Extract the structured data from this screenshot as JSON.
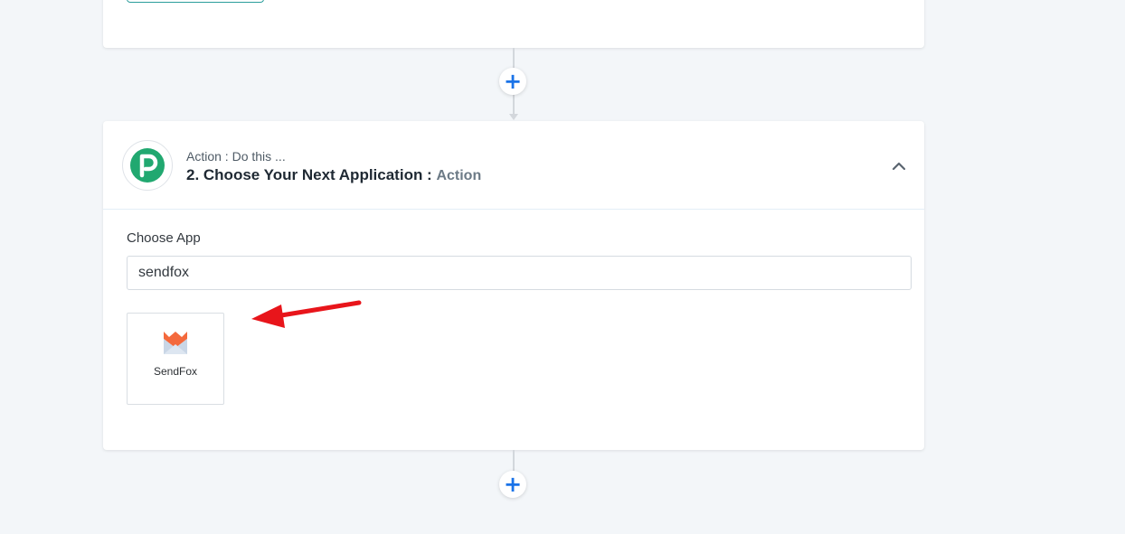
{
  "header": {
    "subtitle": "Action : Do this ...",
    "title": "2. Choose Your Next Application :",
    "title_suffix": "Action"
  },
  "icons": {
    "app_logo": "pabbly-logo-icon",
    "collapse": "chevron-up-icon",
    "add_step": "plus-icon",
    "annotation": "red-arrow-icon"
  },
  "choose_app": {
    "label": "Choose App",
    "search_value": "sendfox"
  },
  "results": [
    {
      "name": "SendFox",
      "icon": "sendfox-icon"
    }
  ],
  "add_step_symbol": "+",
  "colors": {
    "background": "#f3f6f9",
    "accent_blue": "#1a73e8",
    "logo_green": "#21a870",
    "annotation_red": "#e8151b",
    "sendfox_orange": "#f4693c"
  }
}
